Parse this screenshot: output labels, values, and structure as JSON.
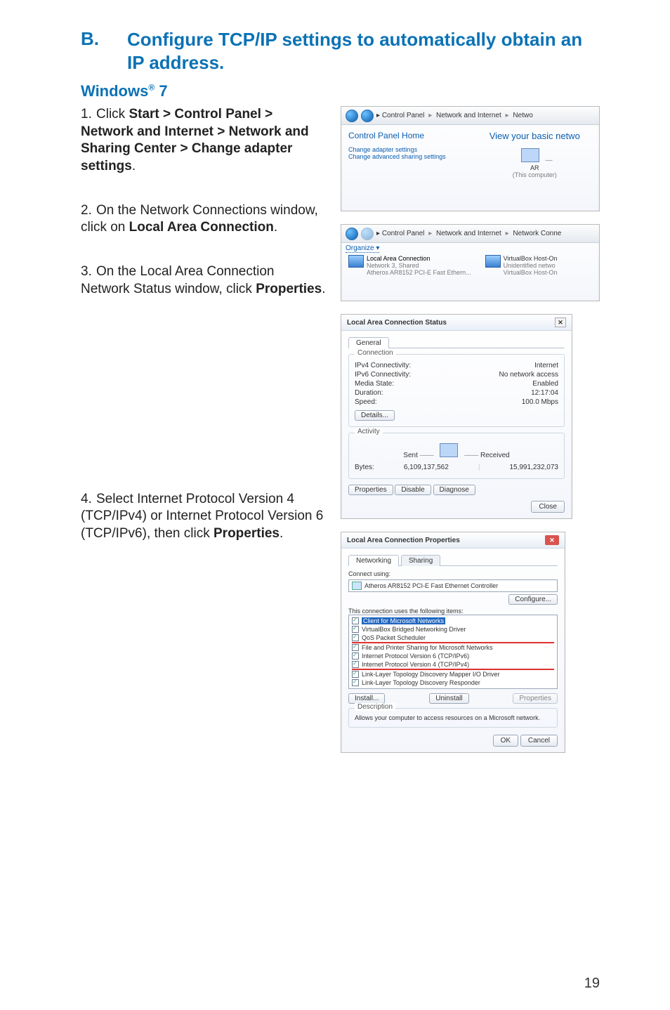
{
  "heading": {
    "label": "B.",
    "text": "Configure TCP/IP settings to automatically obtain an IP address."
  },
  "subhead": {
    "prefix": "Windows",
    "sup": "®",
    "suffix": " 7"
  },
  "steps": {
    "s1": {
      "num": "1.",
      "pre": "Click ",
      "bold": "Start > Control Panel > Network and Internet > Network and Sharing Center > Change adapter settings",
      "post": "."
    },
    "s2": {
      "num": "2.",
      "pre": "On the Network Connections window, click on ",
      "bold": "Local Area Connection",
      "post": "."
    },
    "s3": {
      "num": "3.",
      "pre": "On the Local Area Connection Network Status window, click ",
      "bold": "Properties",
      "post": "."
    },
    "s4": {
      "num": "4.",
      "pre": "Select Internet Protocol Version 4 (TCP/IPv4) or Internet Protocol Version 6 (TCP/IPv6), then click ",
      "bold": "Properties",
      "post": "."
    }
  },
  "shot1": {
    "crumb1": "Control Panel",
    "crumb2": "Network and Internet",
    "crumb3": "Netwo",
    "cph": "Control Panel Home",
    "viewbasic": "View your basic netwo",
    "change_adapter": "Change adapter settings",
    "change_adv": "Change advanced sharing settings",
    "ar": "AR",
    "thiscomp": "(This computer)"
  },
  "shot2": {
    "crumb1": "Control Panel",
    "crumb2": "Network and Internet",
    "crumb3": "Network Conne",
    "organize": "Organize ▾",
    "lac": "Local Area Connection",
    "lac_sub1": "Network 3, Shared",
    "lac_sub2": "Atheros AR8152 PCI-E Fast Ethern...",
    "vb": "VirtualBox Host-On",
    "vb_sub1": "Unidentified netwo",
    "vb_sub2": "VirtualBox Host-On"
  },
  "shot3": {
    "title": "Local Area Connection Status",
    "tab": "General",
    "grp_conn": "Connection",
    "rows": {
      "r1l": "IPv4 Connectivity:",
      "r1r": "Internet",
      "r2l": "IPv6 Connectivity:",
      "r2r": "No network access",
      "r3l": "Media State:",
      "r3r": "Enabled",
      "r4l": "Duration:",
      "r4r": "12:17:04",
      "r5l": "Speed:",
      "r5r": "100.0 Mbps"
    },
    "details": "Details...",
    "grp_act": "Activity",
    "sent": "Sent",
    "recv": "Received",
    "bytesl": "Bytes:",
    "sentv": "6,109,137,562",
    "recvv": "15,991,232,073",
    "props": "Properties",
    "disable": "Disable",
    "diag": "Diagnose",
    "close": "Close"
  },
  "shot4": {
    "title": "Local Area Connection Properties",
    "tab1": "Networking",
    "tab2": "Sharing",
    "connect_using": "Connect using:",
    "adapter": "Atheros AR8152 PCI-E Fast Ethernet Controller",
    "configure": "Configure...",
    "uses": "This connection uses the following items:",
    "items": {
      "i1": "Client for Microsoft Networks",
      "i2": "VirtualBox Bridged Networking Driver",
      "i3": "QoS Packet Scheduler",
      "i4": "File and Printer Sharing for Microsoft Networks",
      "i5": "Internet Protocol Version 6 (TCP/IPv6)",
      "i6": "Internet Protocol Version 4 (TCP/IPv4)",
      "i7": "Link-Layer Topology Discovery Mapper I/O Driver",
      "i8": "Link-Layer Topology Discovery Responder"
    },
    "install": "Install...",
    "uninstall": "Uninstall",
    "props": "Properties",
    "desc_lbl": "Description",
    "desc": "Allows your computer to access resources on a Microsoft network.",
    "ok": "OK",
    "cancel": "Cancel"
  },
  "page": "19"
}
